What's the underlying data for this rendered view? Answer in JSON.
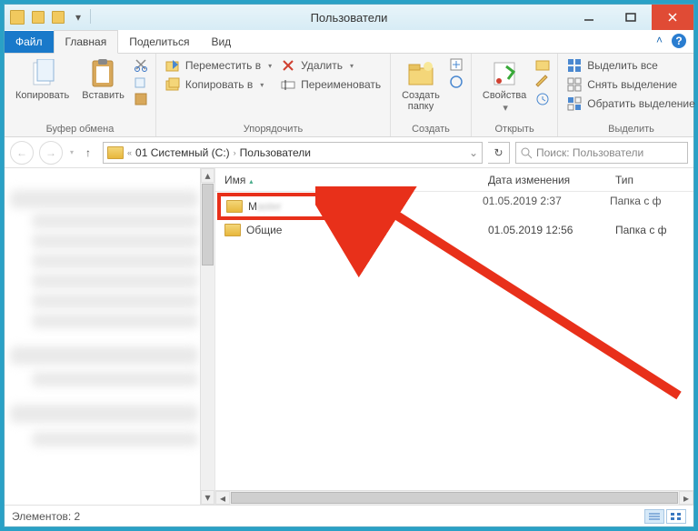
{
  "title": "Пользователи",
  "tabs": {
    "file": "Файл",
    "home": "Главная",
    "share": "Поделиться",
    "view": "Вид"
  },
  "ribbon": {
    "clipboard": {
      "copy": "Копировать",
      "paste": "Вставить",
      "label": "Буфер обмена"
    },
    "organize": {
      "moveTo": "Переместить в",
      "copyTo": "Копировать в",
      "delete": "Удалить",
      "rename": "Переименовать",
      "label": "Упорядочить"
    },
    "new": {
      "newFolder": "Создать\nпапку",
      "label": "Создать"
    },
    "open": {
      "properties": "Свойства",
      "label": "Открыть"
    },
    "select": {
      "selectAll": "Выделить все",
      "selectNone": "Снять выделение",
      "invert": "Обратить выделение",
      "label": "Выделить"
    }
  },
  "breadcrumbs": [
    "01 Системный (C:)",
    "Пользователи"
  ],
  "search": {
    "placeholder": "Поиск: Пользователи"
  },
  "columns": {
    "name": "Имя",
    "date": "Дата изменения",
    "type": "Тип"
  },
  "rows": [
    {
      "name": "M",
      "nameBlur": "aster",
      "date": "01.05.2019 2:37",
      "type": "Папка с ф",
      "highlight": true
    },
    {
      "name": "Общие",
      "date": "01.05.2019 12:56",
      "type": "Папка с ф",
      "highlight": false
    }
  ],
  "status": "Элементов: 2"
}
